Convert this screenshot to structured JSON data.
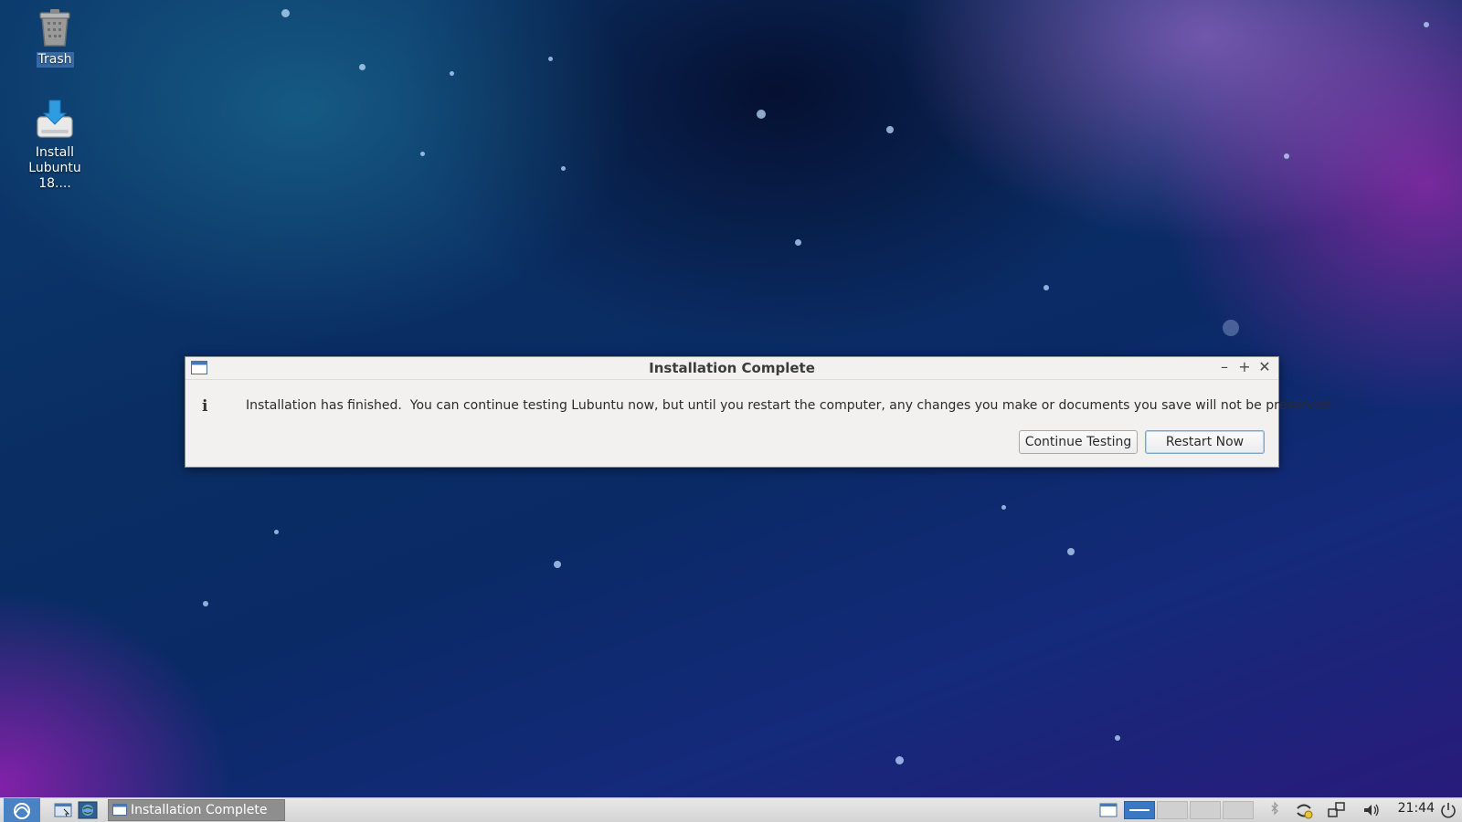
{
  "desktop": {
    "icons": [
      {
        "label": "Trash"
      },
      {
        "label_line1": "Install",
        "label_line2": "Lubuntu 18...."
      }
    ]
  },
  "dialog": {
    "title": "Installation Complete",
    "message": "Installation has finished.  You can continue testing Lubuntu now, but until you restart the computer, any changes you make or documents you save will not be preserved.",
    "info_glyph": "i",
    "buttons": {
      "continue_label": "Continue Testing",
      "restart_label": "Restart Now"
    },
    "controls": {
      "minimize": "–",
      "maximize": "+",
      "close": "✕"
    }
  },
  "taskbar": {
    "task_label": "Installation Complete",
    "clock": "21:44",
    "pager_count": 4,
    "pager_active_index": 0
  },
  "colors": {
    "dialog_bg": "#f2f1f0",
    "taskbar_bg": "#d4d4d4",
    "task_button_bg": "#8e8e8e",
    "pager_active": "#3a78c4"
  }
}
